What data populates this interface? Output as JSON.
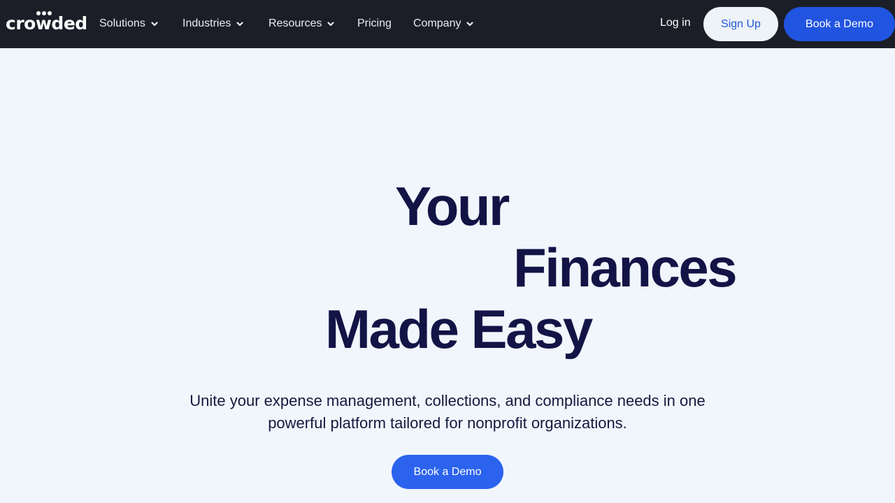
{
  "brand": {
    "logo_text": "crowded"
  },
  "nav": {
    "items": [
      {
        "label": "Solutions",
        "has_dropdown": true
      },
      {
        "label": "Industries",
        "has_dropdown": true
      },
      {
        "label": "Resources",
        "has_dropdown": true
      },
      {
        "label": "Pricing",
        "has_dropdown": false
      },
      {
        "label": "Company",
        "has_dropdown": true
      }
    ],
    "login_label": "Log in",
    "signup_label": "Sign Up",
    "book_demo_label": "Book a Demo"
  },
  "hero": {
    "title_lines": [
      "Your",
      "Finances",
      "Made Easy"
    ],
    "subtitle_line1": "Unite your expense management, collections, and compliance needs in one",
    "subtitle_line2": "powerful platform tailored for nonprofit organizations.",
    "cta_label": "Book a Demo"
  },
  "colors": {
    "nav_bg": "#1b1e27",
    "page_bg": "#f1f6fd",
    "heading": "#121446",
    "accent": "#2154e0"
  },
  "icons": {
    "dropdown": "chevron-down-icon"
  }
}
